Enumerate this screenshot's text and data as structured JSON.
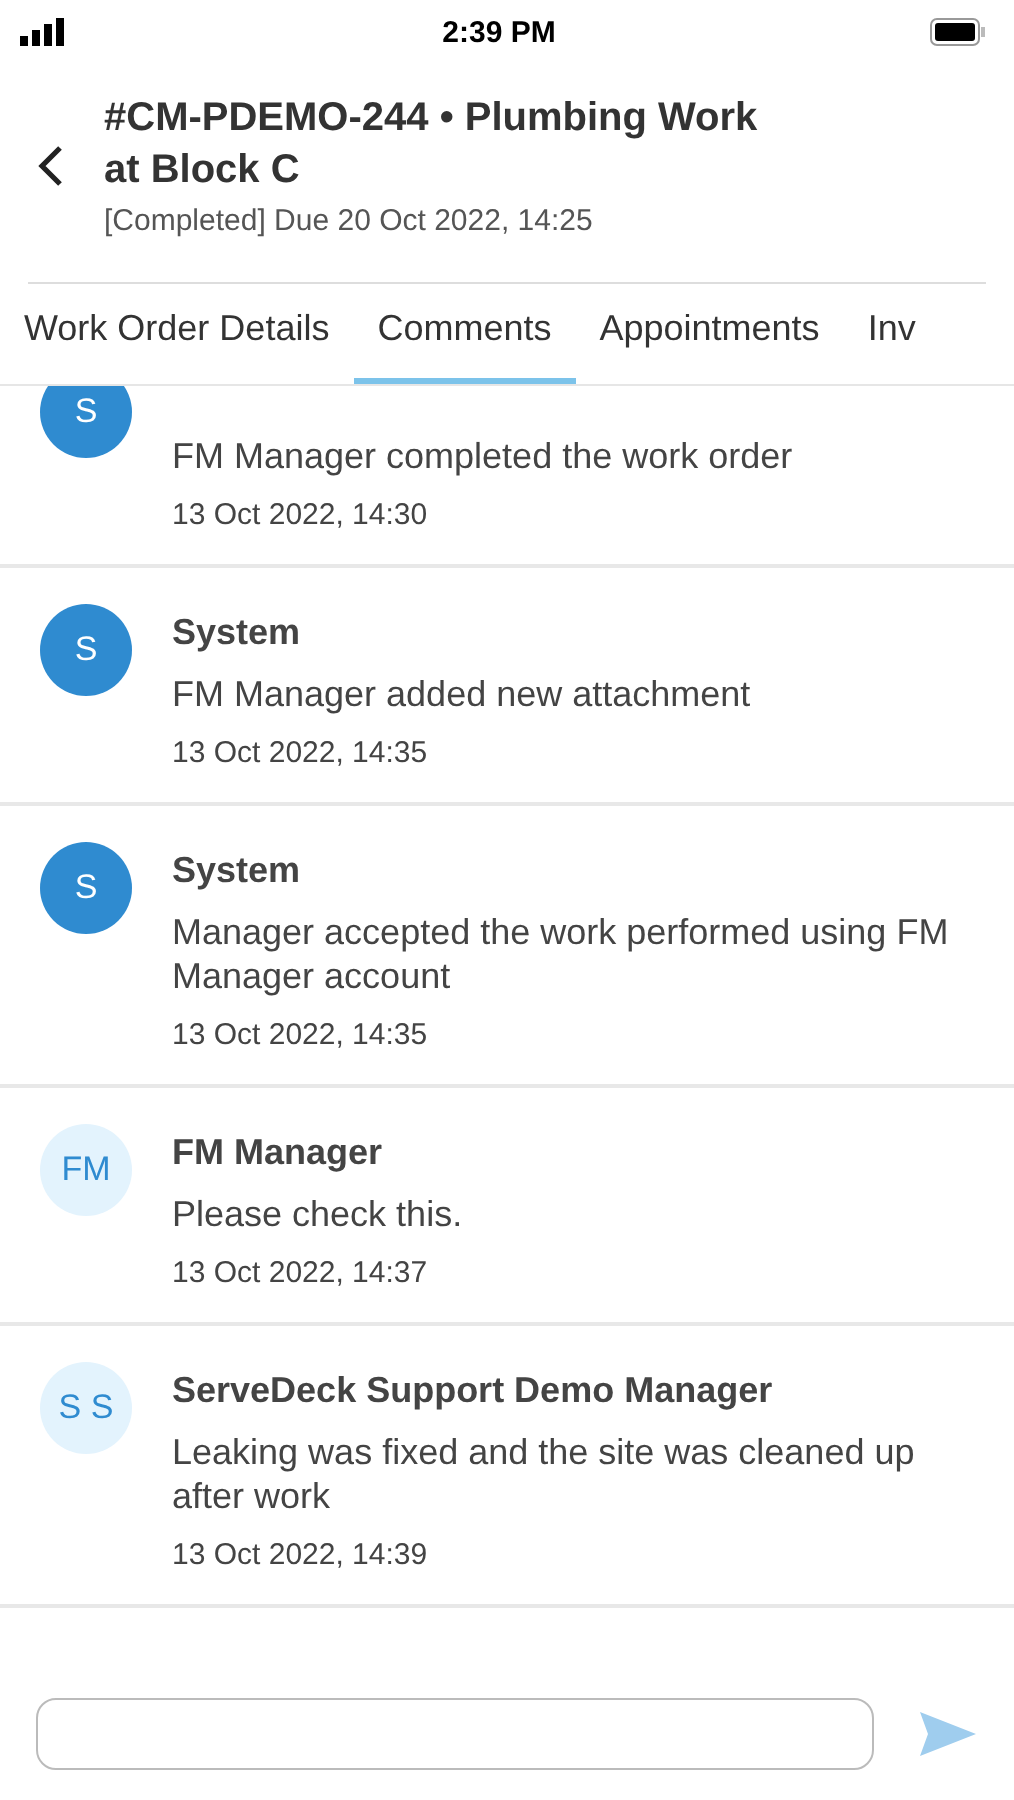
{
  "status_bar": {
    "time": "2:39 PM"
  },
  "header": {
    "title": "#CM-PDEMO-244 • Plumbing Work at Block C",
    "subtitle": "[Completed] Due 20 Oct 2022, 14:25"
  },
  "tabs": [
    {
      "label": "Work Order Details",
      "selected": false
    },
    {
      "label": "Comments",
      "selected": true
    },
    {
      "label": "Appointments",
      "selected": false
    },
    {
      "label": "Inv",
      "selected": false
    }
  ],
  "comments": [
    {
      "kind": "system",
      "initials": "S",
      "text": "FM Manager completed the work order",
      "time": "13 Oct 2022, 14:30"
    },
    {
      "kind": "system",
      "initials": "S",
      "author": "System",
      "text": "FM Manager added new attachment",
      "time": "13 Oct 2022, 14:35"
    },
    {
      "kind": "system",
      "initials": "S",
      "author": "System",
      "text": "Manager accepted the work performed using FM Manager account",
      "time": "13 Oct 2022, 14:35"
    },
    {
      "kind": "user",
      "initials": "FM",
      "author": "FM Manager",
      "text": "Please check this.",
      "time": "13 Oct 2022, 14:37"
    },
    {
      "kind": "user",
      "initials": "S S",
      "author": "ServeDeck Support Demo Manager",
      "text": "Leaking was fixed and the site was cleaned up after work",
      "time": "13 Oct 2022, 14:39"
    }
  ]
}
